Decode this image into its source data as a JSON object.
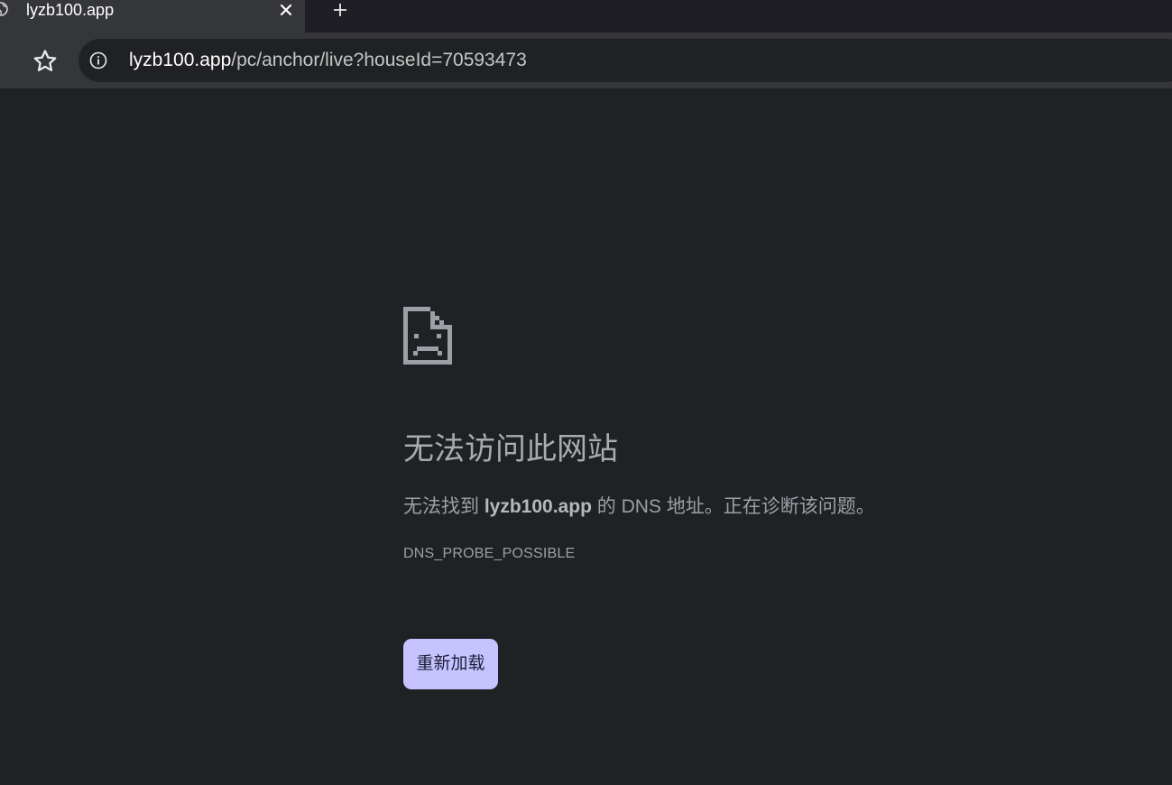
{
  "tab": {
    "title": "lyzb100.app",
    "close_label": "✕",
    "new_tab_label": "+"
  },
  "toolbar": {
    "url_host": "lyzb100.app",
    "url_path": "/pc/anchor/live?houseId=70593473"
  },
  "error": {
    "icon": "sad-page-icon",
    "title": "无法访问此网站",
    "desc_prefix": "无法找到 ",
    "desc_host": "lyzb100.app",
    "desc_suffix": " 的 DNS 地址。正在诊断该问题。",
    "code": "DNS_PROBE_POSSIBLE",
    "reload_label": "重新加载"
  },
  "colors": {
    "background": "#202124",
    "toolbar": "#35363a",
    "reload_button": "#c6c3ff"
  }
}
